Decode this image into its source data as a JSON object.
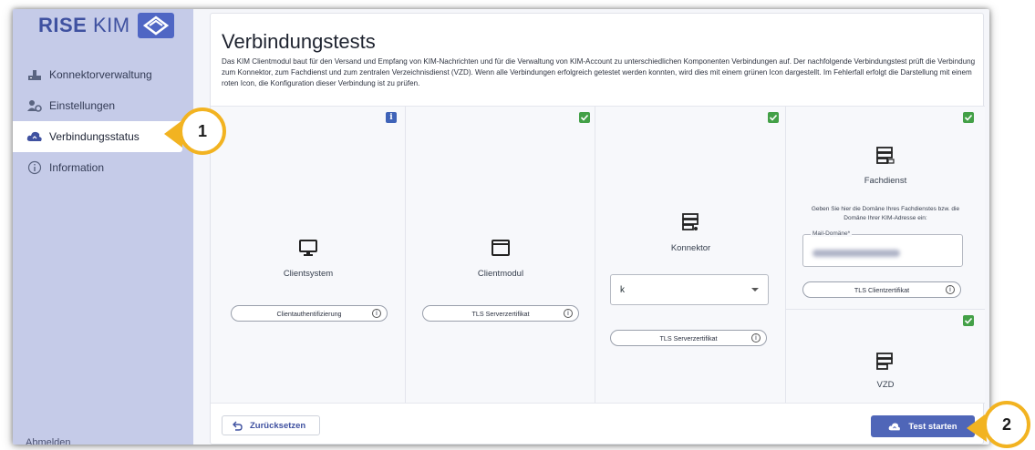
{
  "app": {
    "logo_text": "RISE",
    "logo_text_light": "KIM"
  },
  "sidebar": {
    "items": [
      {
        "label": "Konnektorverwaltung",
        "icon": "connector-icon",
        "active": false
      },
      {
        "label": "Einstellungen",
        "icon": "settings-users-icon",
        "active": false
      },
      {
        "label": "Verbindungsstatus",
        "icon": "cloud-icon",
        "active": true
      },
      {
        "label": "Information",
        "icon": "info-circle-icon",
        "active": false
      }
    ],
    "bottom_label": "Abmelden"
  },
  "main": {
    "title": "Verbindungstests",
    "description": "Das KIM Clientmodul baut für den Versand und Empfang von KIM-Nachrichten und für die Verwaltung von KIM-Account zu unterschiedlichen Komponenten Verbindungen auf. Der nachfolgende Verbindungstest prüft die Verbindung zum Konnektor, zum Fachdienst und zum zentralen Verzeichnisdienst (VZD). Wenn alle Verbindungen erfolgreich getestet werden konnten, wird dies mit einem grünen Icon dargestellt. Im Fehlerfall erfolgt die Darstellung mit einem roten Icon, die Konfiguration dieser Verbindung ist zu prüfen.",
    "components": {
      "clientsystem": {
        "label": "Clientsystem",
        "button": "Clientauthentifizierung",
        "status": "info"
      },
      "clientmodul": {
        "label": "Clientmodul",
        "button": "TLS Serverzertifikat",
        "status": "ok"
      },
      "konnektor": {
        "label": "Konnektor",
        "select_value": "k",
        "button": "TLS Serverzertifikat",
        "status": "ok"
      },
      "fachdienst": {
        "label": "Fachdienst",
        "hint": "Geben Sie hier die Domäne Ihres Fachdienstes bzw. die Domäne Ihrer KIM-Adresse ein:",
        "mail_label": "Mail-Domäne*",
        "button": "TLS Clientzertifikat",
        "status": "ok"
      },
      "vzd": {
        "label": "VZD",
        "status": "ok"
      }
    },
    "reset_label": "Zurücksetzen",
    "start_label": "Test starten"
  },
  "callouts": [
    "1",
    "2"
  ],
  "colors": {
    "accent": "#4f66b8",
    "sidebar": "#c5cbe8",
    "ok": "#43a047",
    "info": "#3f63b8",
    "callout": "#f2b321"
  }
}
